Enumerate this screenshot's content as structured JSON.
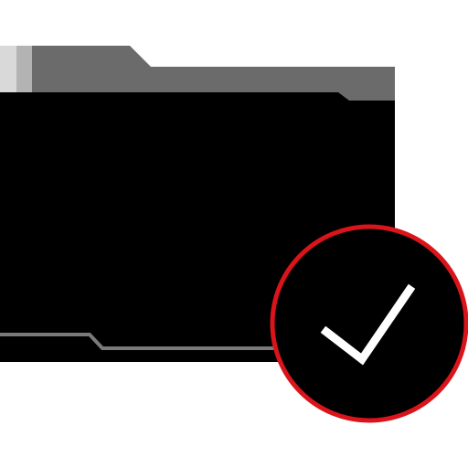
{
  "icon": {
    "name": "folder-check-icon",
    "colors": {
      "background": "#ffffff",
      "folder_body": "#000000",
      "folder_tab": "#6b6b6b",
      "folder_tab_highlight": "#b3b3b3",
      "folder_tab_highlight_light": "#d9d9d9",
      "folder_accent_line": "#7a7a7a",
      "badge_fill": "#000000",
      "badge_ring": "#d9141b",
      "checkmark": "#ffffff"
    }
  }
}
